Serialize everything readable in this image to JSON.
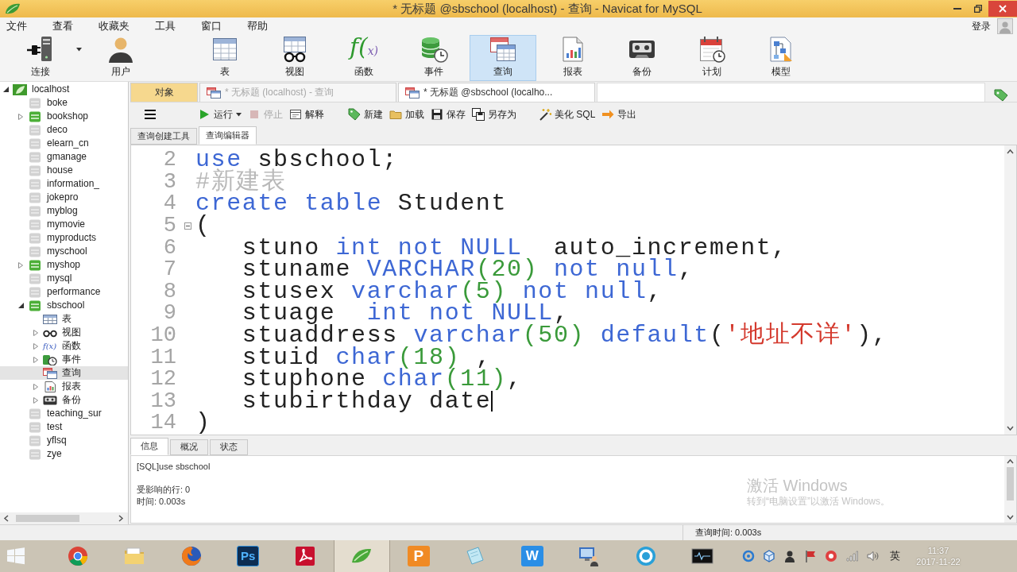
{
  "window": {
    "title": "* 无标题 @sbschool (localhost) - 查询 - Navicat for MySQL"
  },
  "menu_bar": {
    "items": [
      "文件",
      "查看",
      "收藏夹",
      "工具",
      "窗口",
      "帮助"
    ],
    "login": "登录"
  },
  "toolbar": [
    {
      "label": "连接",
      "kind": "connect",
      "menu": true,
      "selected": false
    },
    {
      "label": "用户",
      "kind": "user",
      "menu": false,
      "selected": false
    },
    {
      "label": "表",
      "kind": "table",
      "menu": false,
      "selected": false
    },
    {
      "label": "视图",
      "kind": "view",
      "menu": false,
      "selected": false
    },
    {
      "label": "函数",
      "kind": "function",
      "glyph": "f(x)",
      "menu": false,
      "selected": false
    },
    {
      "label": "事件",
      "kind": "event",
      "menu": false,
      "selected": false
    },
    {
      "label": "查询",
      "kind": "query",
      "menu": false,
      "selected": true
    },
    {
      "label": "报表",
      "kind": "report",
      "menu": false,
      "selected": false
    },
    {
      "label": "备份",
      "kind": "backup",
      "menu": false,
      "selected": false
    },
    {
      "label": "计划",
      "kind": "schedule",
      "menu": false,
      "selected": false
    },
    {
      "label": "模型",
      "kind": "model",
      "menu": false,
      "selected": false
    }
  ],
  "sidebar": {
    "tree": [
      {
        "label": "localhost",
        "kind": "server",
        "selected": false,
        "expanded": true,
        "children": [
          {
            "label": "boke",
            "kind": "database",
            "open": false,
            "selected": false
          },
          {
            "label": "bookshop",
            "kind": "database",
            "open": true,
            "expanded": false,
            "selected": false
          },
          {
            "label": "deco",
            "kind": "database",
            "open": false,
            "selected": false
          },
          {
            "label": "elearn_cn",
            "kind": "database",
            "open": false,
            "selected": false
          },
          {
            "label": "gmanage",
            "kind": "database",
            "open": false,
            "selected": false
          },
          {
            "label": "house",
            "kind": "database",
            "open": false,
            "selected": false
          },
          {
            "label": "information_",
            "kind": "database",
            "open": false,
            "selected": false
          },
          {
            "label": "jokepro",
            "kind": "database",
            "open": false,
            "selected": false
          },
          {
            "label": "myblog",
            "kind": "database",
            "open": false,
            "selected": false
          },
          {
            "label": "mymovie",
            "kind": "database",
            "open": false,
            "selected": false
          },
          {
            "label": "myproducts",
            "kind": "database",
            "open": false,
            "selected": false
          },
          {
            "label": "myschool",
            "kind": "database",
            "open": false,
            "selected": false
          },
          {
            "label": "myshop",
            "kind": "database",
            "open": true,
            "expanded": false,
            "selected": false
          },
          {
            "label": "mysql",
            "kind": "database",
            "open": false,
            "selected": false
          },
          {
            "label": "performance",
            "kind": "database",
            "open": false,
            "selected": false
          },
          {
            "label": "sbschool",
            "kind": "database",
            "open": true,
            "expanded": true,
            "selected": false,
            "children": [
              {
                "label": "表",
                "kind": "tables",
                "selected": false
              },
              {
                "label": "视图",
                "kind": "views",
                "expanded": false,
                "selected": false
              },
              {
                "label": "函数",
                "kind": "functions",
                "glyph": "f(x)",
                "expanded": false,
                "selected": false
              },
              {
                "label": "事件",
                "kind": "events",
                "expanded": false,
                "selected": false
              },
              {
                "label": "查询",
                "kind": "queries",
                "selected": true
              },
              {
                "label": "报表",
                "kind": "reports",
                "expanded": false,
                "selected": false
              },
              {
                "label": "备份",
                "kind": "backups",
                "expanded": false,
                "selected": false
              }
            ]
          },
          {
            "label": "teaching_sur",
            "kind": "database",
            "open": false,
            "selected": false
          },
          {
            "label": "test",
            "kind": "database",
            "open": false,
            "selected": false
          },
          {
            "label": "yflsq",
            "kind": "database",
            "open": false,
            "selected": false
          },
          {
            "label": "zye",
            "kind": "database",
            "open": false,
            "selected": false
          }
        ]
      }
    ]
  },
  "document_tabs": [
    {
      "label": "对象",
      "kind": "objects",
      "selected": false
    },
    {
      "label": "* 无标题 (localhost) - 查询",
      "kind": "query",
      "selected": false
    },
    {
      "label": "* 无标题 @sbschool (localho...",
      "kind": "query",
      "selected": true
    }
  ],
  "query_toolbar": [
    {
      "kind": "menu",
      "menu": false,
      "disabled": false
    },
    {
      "kind": "run",
      "label": "运行",
      "menu": true,
      "disabled": false
    },
    {
      "kind": "stop",
      "label": "停止",
      "menu": false,
      "disabled": true
    },
    {
      "kind": "explain",
      "label": "解释",
      "menu": false,
      "disabled": false
    },
    {
      "kind": "new",
      "label": "新建",
      "menu": false,
      "disabled": false
    },
    {
      "kind": "load",
      "label": "加载",
      "menu": false,
      "disabled": false
    },
    {
      "kind": "save",
      "label": "保存",
      "menu": false,
      "disabled": false
    },
    {
      "kind": "saveas",
      "label": "另存为",
      "menu": false,
      "disabled": false
    },
    {
      "kind": "beautify",
      "label": "美化 SQL",
      "menu": false,
      "disabled": false
    },
    {
      "kind": "export",
      "label": "导出",
      "menu": false,
      "disabled": false
    }
  ],
  "editor_tabs": [
    {
      "label": "查询创建工具",
      "selected": false
    },
    {
      "label": "查询编辑器",
      "selected": true
    }
  ],
  "editor": {
    "lines": [
      {
        "number": "2",
        "fold": false,
        "cursor": false,
        "tokens": [
          {
            "text": "use",
            "kind": "keyword"
          },
          {
            "text": " sbschool;",
            "kind": "plain"
          }
        ]
      },
      {
        "number": "3",
        "fold": false,
        "cursor": false,
        "tokens": [
          {
            "text": "#新建表",
            "kind": "comment"
          }
        ]
      },
      {
        "number": "4",
        "fold": false,
        "cursor": false,
        "tokens": [
          {
            "text": "create table",
            "kind": "keyword"
          },
          {
            "text": " Student",
            "kind": "plain"
          }
        ]
      },
      {
        "number": "5",
        "fold": true,
        "cursor": false,
        "tokens": [
          {
            "text": "(",
            "kind": "plain"
          }
        ]
      },
      {
        "number": "6",
        "fold": false,
        "cursor": false,
        "tokens": [
          {
            "text": "   stuno ",
            "kind": "plain"
          },
          {
            "text": "int not NULL",
            "kind": "keyword"
          },
          {
            "text": "  auto_increment,",
            "kind": "plain"
          }
        ]
      },
      {
        "number": "7",
        "fold": false,
        "cursor": false,
        "tokens": [
          {
            "text": "   stuname ",
            "kind": "plain"
          },
          {
            "text": "VARCHAR",
            "kind": "keyword"
          },
          {
            "text": "(20)",
            "kind": "number"
          },
          {
            "text": " not null",
            "kind": "keyword"
          },
          {
            "text": ",",
            "kind": "plain"
          }
        ]
      },
      {
        "number": "8",
        "fold": false,
        "cursor": false,
        "tokens": [
          {
            "text": "   stusex ",
            "kind": "plain"
          },
          {
            "text": "varchar",
            "kind": "keyword"
          },
          {
            "text": "(5)",
            "kind": "number"
          },
          {
            "text": " not null",
            "kind": "keyword"
          },
          {
            "text": ",",
            "kind": "plain"
          }
        ]
      },
      {
        "number": "9",
        "fold": false,
        "cursor": false,
        "tokens": [
          {
            "text": "   stuage  ",
            "kind": "plain"
          },
          {
            "text": "int not NULL",
            "kind": "keyword"
          },
          {
            "text": ",",
            "kind": "plain"
          }
        ]
      },
      {
        "number": "10",
        "fold": false,
        "cursor": false,
        "tokens": [
          {
            "text": "   stuaddress ",
            "kind": "plain"
          },
          {
            "text": "varchar",
            "kind": "keyword"
          },
          {
            "text": "(50)",
            "kind": "number"
          },
          {
            "text": " default",
            "kind": "keyword"
          },
          {
            "text": "(",
            "kind": "plain"
          },
          {
            "text": "'地址不详'",
            "kind": "string"
          },
          {
            "text": "),",
            "kind": "plain"
          }
        ]
      },
      {
        "number": "11",
        "fold": false,
        "cursor": false,
        "tokens": [
          {
            "text": "   stuid ",
            "kind": "plain"
          },
          {
            "text": "char",
            "kind": "keyword"
          },
          {
            "text": "(18)",
            "kind": "number"
          },
          {
            "text": " ,",
            "kind": "plain"
          }
        ]
      },
      {
        "number": "12",
        "fold": false,
        "cursor": false,
        "tokens": [
          {
            "text": "   stuphone ",
            "kind": "plain"
          },
          {
            "text": "char",
            "kind": "keyword"
          },
          {
            "text": "(11)",
            "kind": "number"
          },
          {
            "text": ",",
            "kind": "plain"
          }
        ]
      },
      {
        "number": "13",
        "fold": false,
        "cursor": true,
        "tokens": [
          {
            "text": "   stubirthday date",
            "kind": "plain"
          }
        ]
      },
      {
        "number": "14",
        "fold": false,
        "cursor": false,
        "tokens": [
          {
            "text": ")",
            "kind": "plain"
          }
        ]
      }
    ]
  },
  "result_tabs": [
    {
      "label": "信息",
      "selected": true
    },
    {
      "label": "概况",
      "selected": false
    },
    {
      "label": "状态",
      "selected": false
    }
  ],
  "messages": [
    [
      "[SQL]use sbschool"
    ],
    [
      "受影响的行: 0",
      "时间: 0.003s"
    ]
  ],
  "activation_notice": {
    "title": "激活 Windows",
    "text": "转到“电脑设置”以激活 Windows。"
  },
  "status_bar": {
    "query_time": "查询时间: 0.003s"
  },
  "taskbar": {
    "apps": [
      {
        "kind": "start",
        "selected": false
      },
      {
        "kind": "browser",
        "selected": false
      },
      {
        "kind": "files",
        "selected": false
      },
      {
        "kind": "globe",
        "selected": false
      },
      {
        "kind": "photo",
        "glyph": "Ps",
        "selected": false
      },
      {
        "kind": "pdf",
        "selected": false
      },
      {
        "kind": "navicat",
        "selected": true
      },
      {
        "kind": "slides",
        "glyph": "P",
        "selected": false
      },
      {
        "kind": "notes",
        "selected": false
      },
      {
        "kind": "writer",
        "glyph": "W",
        "selected": false
      },
      {
        "kind": "remote",
        "selected": false
      },
      {
        "kind": "ring",
        "selected": false
      },
      {
        "kind": "terminal",
        "selected": false
      }
    ],
    "input_method": "英",
    "time": "11:37",
    "date": "2017-11-22"
  }
}
